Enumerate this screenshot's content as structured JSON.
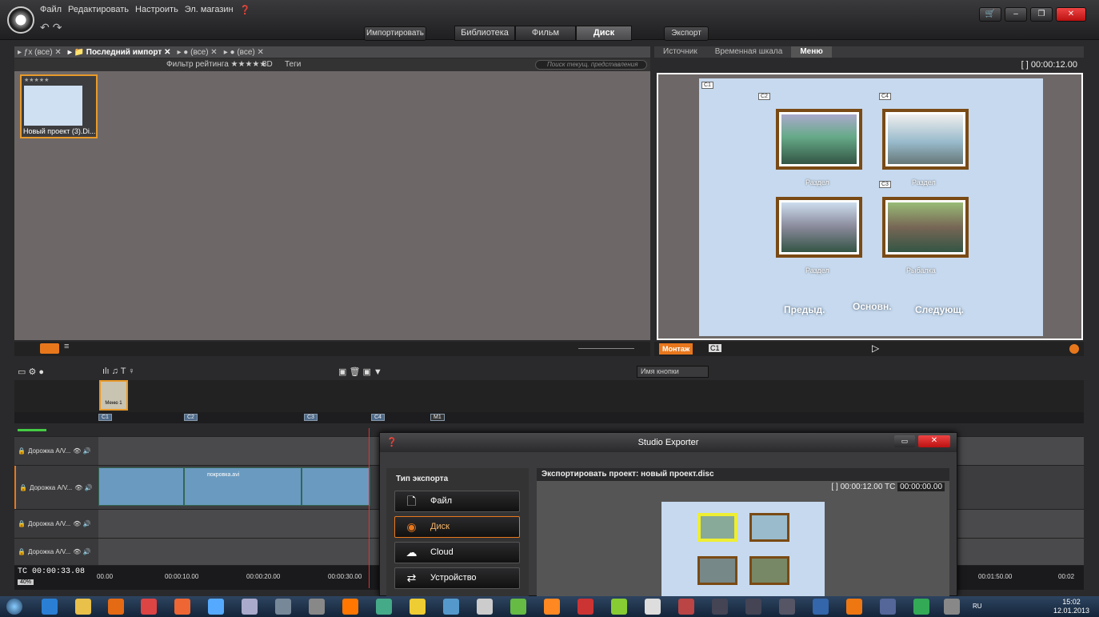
{
  "menu": {
    "file": "Файл",
    "edit": "Редактировать",
    "settings": "Настроить",
    "store": "Эл. магазин"
  },
  "toolbar": {
    "import": "Импортировать",
    "export": "Экспорт"
  },
  "tabs": {
    "library": "Библиотека",
    "movie": "Фильм",
    "disc": "Диск"
  },
  "library": {
    "filters": [
      "(все)",
      "Последний импорт",
      "(все)",
      "(все)"
    ],
    "rating_filter": "Фильтр рейтинга ★★★★★",
    "mode_3d": "3D",
    "tags": "Теги",
    "search_placeholder": "Поиск текущ. представления",
    "item_title": "Новый проект (3).Di..."
  },
  "player": {
    "tabs": [
      "Источник",
      "Временная шкала",
      "Меню"
    ],
    "active_tab": "Меню",
    "time": "[ ] 00:00:12.00",
    "chapters": [
      "C1",
      "C2",
      "C4",
      "C3"
    ],
    "captions": [
      "Раздел",
      "Раздел",
      "Раздел",
      "Рыбалка"
    ],
    "nav_prev": "Предыд.",
    "nav_main": "Основн.",
    "nav_next": "Следующ.",
    "montage": "Монтаж",
    "chapter_badge": "C1"
  },
  "timeline": {
    "button_name": "Имя кнопки",
    "menu_thumb": "Меню 1",
    "markers": [
      "C1",
      "C2",
      "C3",
      "C4",
      "M1"
    ],
    "tracks": [
      "Дорожка А/V...",
      "Дорожка А/V...",
      "Дорожка А/V...",
      "Дорожка А/V..."
    ],
    "clip_label": "покровка.avi",
    "tc": "TC  00:00:33.08",
    "zoom": "40%",
    "ticks": [
      "00.00",
      "00:00:10.00",
      "00:00:20.00",
      "00:00:30.00",
      "00:01:50.00",
      "00:02"
    ]
  },
  "exporter": {
    "title": "Studio Exporter",
    "export_type": "Тип экспорта",
    "types": [
      "Файл",
      "Диск",
      "Cloud",
      "Устройство"
    ],
    "selected": "Диск",
    "project": "Экспортировать проект: новый проект.disc",
    "time": "[ ] 00:00:12.00",
    "tc_label": "TC",
    "tc_value": "00:00:00.00"
  },
  "taskbar": {
    "lang": "RU",
    "time": "15:02",
    "date": "12.01.2013"
  },
  "colors": {
    "accent": "#e8771c",
    "panel": "#6d6867",
    "menu_bg": "#c6d9ee"
  }
}
